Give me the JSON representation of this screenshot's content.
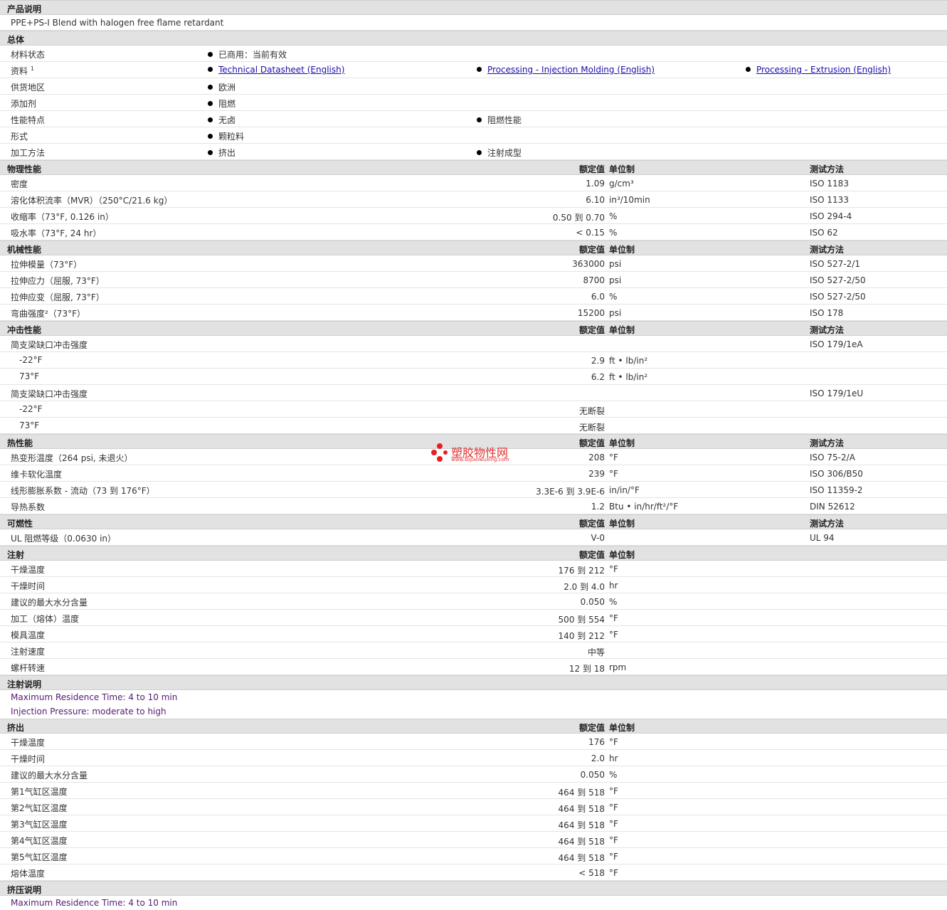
{
  "product_desc": {
    "title": "产品说明",
    "text": "PPE+PS-I Blend with halogen free flame retardant"
  },
  "general": {
    "title": "总体",
    "rows": [
      {
        "label": "材料状态",
        "items": [
          "已商用：当前有效"
        ]
      },
      {
        "label": "资料",
        "sup": "1",
        "links": [
          "Technical Datasheet (English)",
          "Processing - Injection Molding (English)",
          "Processing - Extrusion (English)"
        ]
      },
      {
        "label": "供货地区",
        "items": [
          "欧洲"
        ]
      },
      {
        "label": "添加剂",
        "items": [
          "阻燃"
        ]
      },
      {
        "label": "性能特点",
        "items": [
          "无卤",
          "阻燃性能"
        ]
      },
      {
        "label": "形式",
        "items": [
          "颗粒料"
        ]
      },
      {
        "label": "加工方法",
        "items": [
          "挤出",
          "注射成型"
        ]
      }
    ]
  },
  "cols": {
    "nominal": "额定值",
    "unit": "单位制",
    "method": "测试方法"
  },
  "physical": {
    "title": "物理性能",
    "rows": [
      {
        "label": "密度",
        "value": "1.09",
        "unit": "g/cm³",
        "method": "ISO 1183"
      },
      {
        "label": "溶化体积流率（MVR）（250°C/21.6 kg）",
        "value": "6.10",
        "unit": "in³/10min",
        "method": "ISO 1133"
      },
      {
        "label": "收缩率（73°F, 0.126 in）",
        "value": "0.50 到 0.70",
        "unit": "%",
        "method": "ISO 294-4"
      },
      {
        "label": "吸水率（73°F, 24 hr）",
        "value": "< 0.15",
        "unit": "%",
        "method": "ISO 62"
      }
    ]
  },
  "mechanical": {
    "title": "机械性能",
    "rows": [
      {
        "label": "拉伸模量（73°F）",
        "value": "363000",
        "unit": "psi",
        "method": "ISO 527-2/1"
      },
      {
        "label": "拉伸应力（屈服, 73°F）",
        "value": "8700",
        "unit": "psi",
        "method": "ISO 527-2/50"
      },
      {
        "label": "拉伸应变（屈服, 73°F）",
        "value": "6.0",
        "unit": "%",
        "method": "ISO 527-2/50"
      },
      {
        "label": "弯曲强度²（73°F）",
        "value": "15200",
        "unit": "psi",
        "method": "ISO 178"
      }
    ]
  },
  "impact": {
    "title": "冲击性能",
    "rows": [
      {
        "label": "简支梁缺口冲击强度",
        "value": "",
        "unit": "",
        "method": "ISO 179/1eA"
      },
      {
        "label": "-22°F",
        "indent": true,
        "value": "2.9",
        "unit": "ft • lb/in²",
        "method": ""
      },
      {
        "label": "73°F",
        "indent": true,
        "value": "6.2",
        "unit": "ft • lb/in²",
        "method": ""
      },
      {
        "label": "简支梁缺口冲击强度",
        "value": "",
        "unit": "",
        "method": "ISO 179/1eU"
      },
      {
        "label": "-22°F",
        "indent": true,
        "value": "无断裂",
        "unit": "",
        "method": ""
      },
      {
        "label": "73°F",
        "indent": true,
        "value": "无断裂",
        "unit": "",
        "method": ""
      }
    ]
  },
  "thermal": {
    "title": "热性能",
    "rows": [
      {
        "label": "热变形温度（264 psi, 未退火）",
        "value": "208",
        "unit": "°F",
        "method": "ISO 75-2/A"
      },
      {
        "label": "维卡软化温度",
        "value": "239",
        "unit": "°F",
        "method": "ISO 306/B50"
      },
      {
        "label": "线形膨胀系数 - 流动（73 到 176°F）",
        "value": "3.3E-6 到 3.9E-6",
        "unit": "in/in/°F",
        "method": "ISO 11359-2"
      },
      {
        "label": "导热系数",
        "value": "1.2",
        "unit": "Btu • in/hr/ft²/°F",
        "method": "DIN 52612"
      }
    ]
  },
  "flammability": {
    "title": "可燃性",
    "rows": [
      {
        "label": "UL 阻燃等级（0.0630 in）",
        "value": "V-0",
        "unit": "",
        "method": "UL 94"
      }
    ]
  },
  "injection": {
    "title": "注射",
    "rows": [
      {
        "label": "干燥温度",
        "value": "176 到 212",
        "unit": "°F"
      },
      {
        "label": "干燥时间",
        "value": "2.0 到 4.0",
        "unit": "hr"
      },
      {
        "label": "建议的最大水分含量",
        "value": "0.050",
        "unit": "%"
      },
      {
        "label": "加工（熔体）温度",
        "value": "500 到 554",
        "unit": "°F"
      },
      {
        "label": "模具温度",
        "value": "140 到 212",
        "unit": "°F"
      },
      {
        "label": "注射速度",
        "value": "中等",
        "unit": ""
      },
      {
        "label": "螺杆转速",
        "value": "12 到 18",
        "unit": "rpm"
      }
    ]
  },
  "injection_notes": {
    "title": "注射说明",
    "lines": [
      "Maximum Residence Time: 4 to 10 min",
      "Injection Pressure: moderate to high"
    ]
  },
  "extrusion": {
    "title": "挤出",
    "rows": [
      {
        "label": "干燥温度",
        "value": "176",
        "unit": "°F"
      },
      {
        "label": "干燥时间",
        "value": "2.0",
        "unit": "hr"
      },
      {
        "label": "建议的最大水分含量",
        "value": "0.050",
        "unit": "%"
      },
      {
        "label": "第1气缸区温度",
        "value": "464 到 518",
        "unit": "°F"
      },
      {
        "label": "第2气缸区温度",
        "value": "464 到 518",
        "unit": "°F"
      },
      {
        "label": "第3气缸区温度",
        "value": "464 到 518",
        "unit": "°F"
      },
      {
        "label": "第4气缸区温度",
        "value": "464 到 518",
        "unit": "°F"
      },
      {
        "label": "第5气缸区温度",
        "value": "464 到 518",
        "unit": "°F"
      },
      {
        "label": "熔体温度",
        "value": "< 518",
        "unit": "°F"
      }
    ]
  },
  "extrusion_notes": {
    "title": "挤压说明",
    "lines": [
      "Maximum Residence Time: 4 to 10 min"
    ]
  },
  "watermark": {
    "text": "塑胶物性网",
    "url": "www.sujiaowuxing.com"
  }
}
